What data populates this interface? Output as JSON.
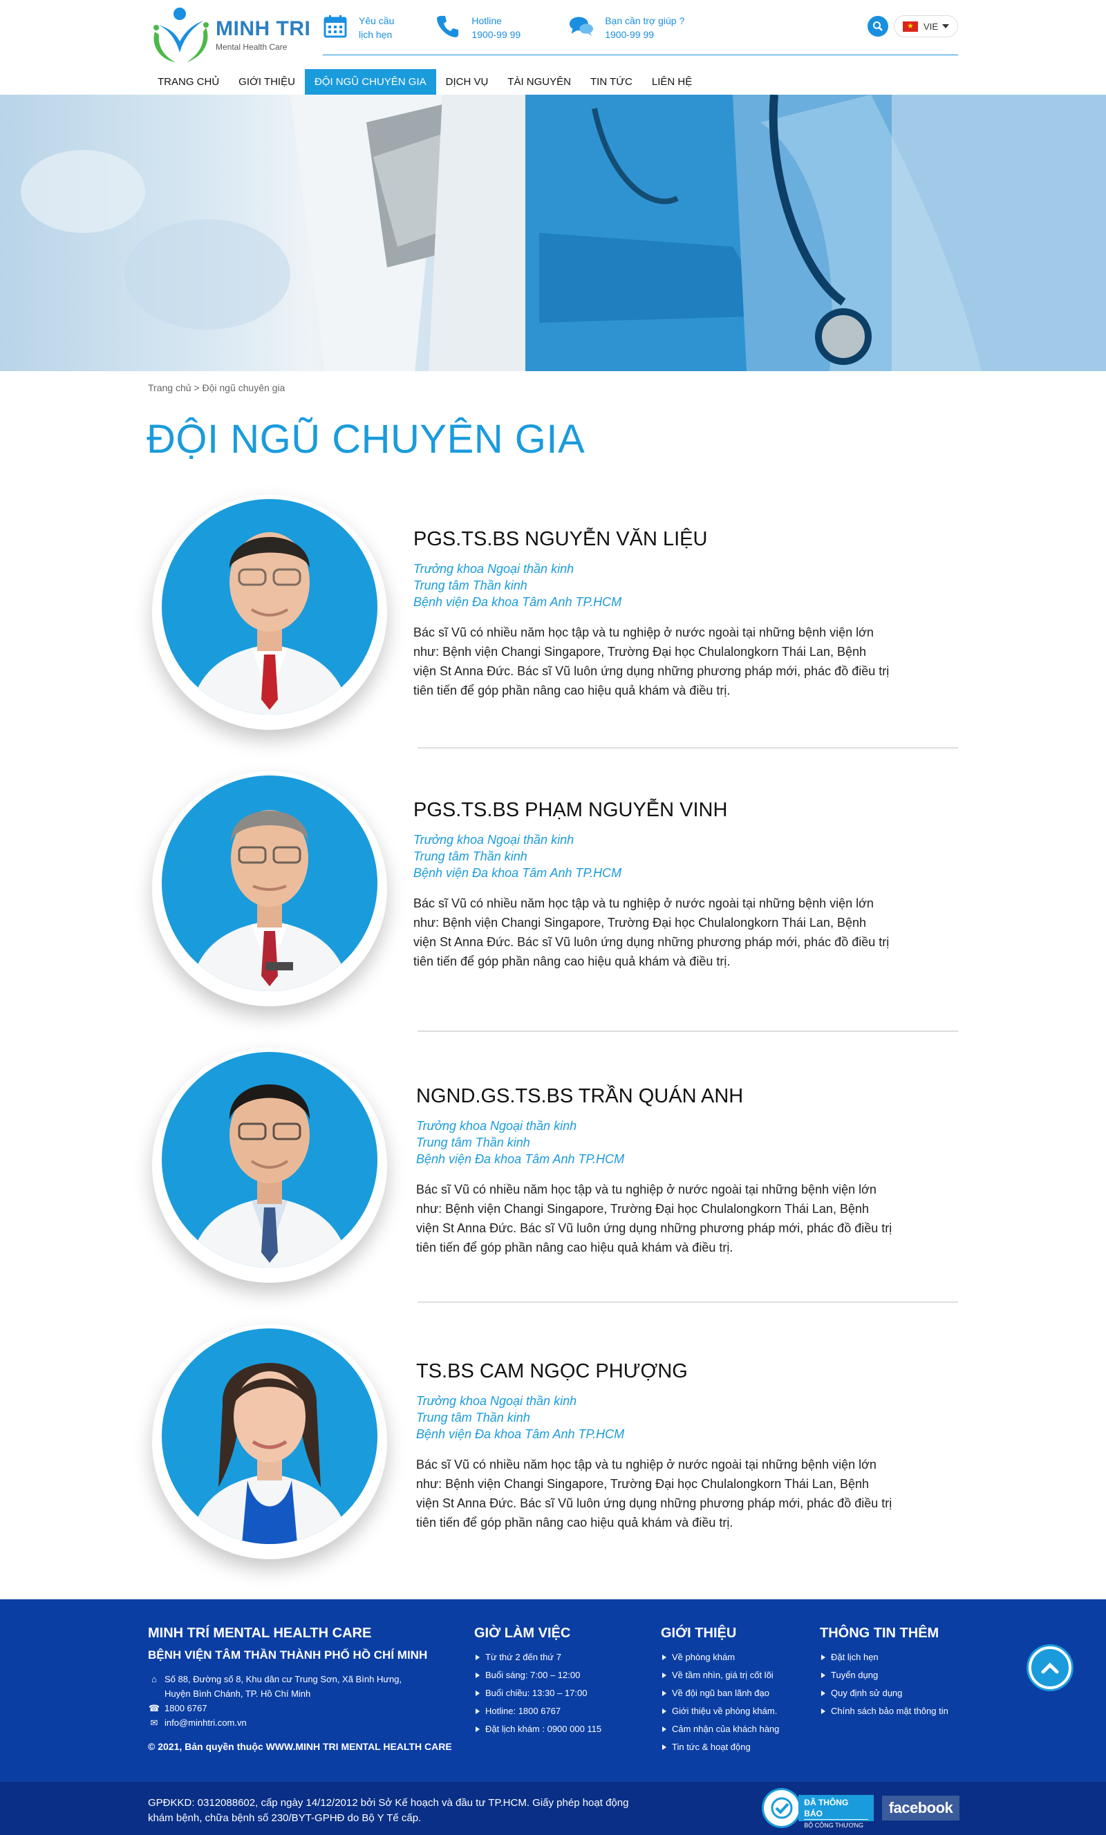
{
  "header": {
    "logo_title": "MINH TRI",
    "logo_sub": "Mental Health Care",
    "appointment": [
      "Yêu cầu",
      "lịch hẹn"
    ],
    "hotline": [
      "Hotline",
      "1900-99 99"
    ],
    "support": [
      "Bạn cần trợ giúp ?",
      "1900-99 99"
    ],
    "lang": "VIE"
  },
  "nav": [
    "TRANG CHỦ",
    "GIỚI THIỆU",
    "ĐỘI NGŨ CHUYÊN GIA",
    "DỊCH VỤ",
    "TÀI NGUYÊN",
    "TIN TỨC",
    "LIÊN HỆ"
  ],
  "breadcrumb": {
    "home": "Trang chủ",
    "sep": " > ",
    "current": "Đội ngũ chuyên gia"
  },
  "page_title": "ĐỘI NGŨ CHUYÊN GIA",
  "doctors": [
    {
      "name": "PGS.TS.BS NGUYỄN VĂN LIỆU",
      "role1": "Trưởng khoa Ngoại thần kinh",
      "role2": "Trung tâm Thần kinh",
      "role3": "Bệnh viện Đa khoa Tâm Anh TP.HCM",
      "desc": "Bác sĩ Vũ có nhiều năm học tập và tu nghiệp ở nước ngoài tại những bệnh viện lớn như: Bệnh viện Changi Singapore, Trường Đại học Chulalongkorn Thái Lan, Bệnh viện St Anna Đức. Bác sĩ Vũ luôn ứng dụng những phương pháp mới, phác đồ điều trị tiên tiến để góp phần nâng cao hiệu quả khám và điều trị."
    },
    {
      "name": "PGS.TS.BS PHẠM NGUYỄN VINH",
      "role1": "Trưởng khoa Ngoại thần kinh",
      "role2": "Trung tâm Thần kinh",
      "role3": "Bệnh viện Đa khoa Tâm Anh TP.HCM",
      "desc": "Bác sĩ Vũ có nhiều năm học tập và tu nghiệp ở nước ngoài tại những bệnh viện lớn như: Bệnh viện Changi Singapore, Trường Đại học Chulalongkorn Thái Lan, Bệnh viện St Anna Đức. Bác sĩ Vũ luôn ứng dụng những phương pháp mới, phác đồ điều trị tiên tiến để góp phần nâng cao hiệu quả khám và điều trị."
    },
    {
      "name": "NGND.GS.TS.BS TRẦN QUÁN ANH",
      "role1": "Trưởng khoa Ngoại thần kinh",
      "role2": "Trung tâm Thần kinh",
      "role3": "Bệnh viện Đa khoa Tâm Anh TP.HCM",
      "desc": "Bác sĩ Vũ có nhiều năm học tập và tu nghiệp ở nước ngoài tại những bệnh viện lớn như: Bệnh viện Changi Singapore, Trường Đại học Chulalongkorn Thái Lan, Bệnh viện St Anna Đức. Bác sĩ Vũ luôn ứng dụng những phương pháp mới, phác đồ điều trị tiên tiến để góp phần nâng cao hiệu quả khám và điều trị."
    },
    {
      "name": "TS.BS CAM NGỌC PHƯỢNG",
      "role1": "Trưởng khoa Ngoại thần kinh",
      "role2": "Trung tâm Thần kinh",
      "role3": "Bệnh viện Đa khoa Tâm Anh TP.HCM",
      "desc": "Bác sĩ Vũ có nhiều năm học tập và tu nghiệp ở nước ngoài tại những bệnh viện lớn như: Bệnh viện Changi Singapore, Trường Đại học Chulalongkorn Thái Lan, Bệnh viện St Anna Đức. Bác sĩ Vũ luôn ứng dụng những phương pháp mới, phác đồ điều trị tiên tiến để góp phần nâng cao hiệu quả khám và điều trị."
    }
  ],
  "footer": {
    "org_title": "MINH TRÍ MENTAL HEALTH CARE",
    "org_sub": "BỆNH VIỆN TÂM THẦN THÀNH PHỐ HỒ CHÍ MINH",
    "address": [
      "Số 88, Đường số 8, Khu dân cư Trung Sơn, Xã Bình Hưng,",
      "Huyện Bình Chánh, TP. Hồ Chí Minh"
    ],
    "phone": "1800 6767",
    "email": "info@minhtri.com.vn",
    "copyright": "© 2021, Bản quyền thuộc WWW.MINH TRI MENTAL HEALTH CARE",
    "hours_title": "GIỜ LÀM VIỆC",
    "hours": [
      "Từ thứ 2 đến thứ 7",
      "Buổi sáng: 7:00 – 12:00",
      "Buổi chiều: 13:30 – 17:00",
      "Hotline: 1800 6767",
      "Đặt lịch khám : 0900 000 115"
    ],
    "about_title": "GIỚI THIỆU",
    "about": [
      "Về phòng khám",
      "Về tầm nhìn, giá trị cốt lõi",
      "Về đội ngũ ban lãnh đạo",
      "Giới thiệu về phòng khám.",
      "Cảm nhận của khách hàng",
      "Tin tức & hoạt động"
    ],
    "more_title": "THÔNG TIN THÊM",
    "more": [
      "Đặt lịch hẹn",
      "Tuyển dụng",
      "Quy định sử dụng",
      "Chính sách bảo mật thông tin"
    ]
  },
  "bottom": {
    "license_1": "GPĐKKD: 0312088602, cấp ngày 14/12/2012 bởi Sở Kế hoạch và đầu tư TP.HCM. Giấy phép hoạt động",
    "license_2": "khám bệnh, chữa bệnh số 230/BYT-GPHĐ do Bộ Y Tế cấp.",
    "bct_main": "ĐÃ THÔNG BÁO",
    "bct_sub": "BỘ CÔNG THƯƠNG",
    "facebook": "facebook"
  },
  "colors": {
    "primary": "#1a9bdc",
    "footer": "#0b3ea3",
    "bottom": "#0a2f86"
  }
}
